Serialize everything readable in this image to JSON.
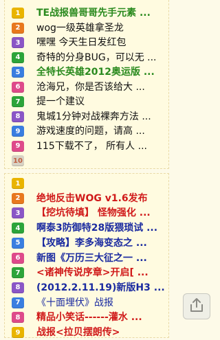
{
  "colors": {
    "green": "#2a8a1e",
    "black": "#111111",
    "red": "#d01a1a",
    "blue": "#1a2aa0",
    "badge_yellow": "#e9b400",
    "badge_orange": "#e8781e",
    "badge_purple": "#8a56c6",
    "badge_green": "#2ca43a",
    "badge_blue": "#3a7ee0",
    "badge_pink": "#de4a8a",
    "badge_grey": "#d8d2c4"
  },
  "list1": [
    {
      "num": "1",
      "text": "TE战报兽哥哥先手元素 ...",
      "color": "green",
      "bold": true
    },
    {
      "num": "2",
      "text": "wog一级英雄拿圣龙",
      "color": "black",
      "bold": false
    },
    {
      "num": "3",
      "text": "嘿嘿 今天生日发红包",
      "color": "black",
      "bold": false
    },
    {
      "num": "4",
      "text": "奇特的分身BUG，可以无 ...",
      "color": "black",
      "bold": false
    },
    {
      "num": "5",
      "text": "全特长英雄2012奥运版 ...",
      "color": "green",
      "bold": true
    },
    {
      "num": "6",
      "text": "沧海兄，你是否该给大 ...",
      "color": "black",
      "bold": false
    },
    {
      "num": "7",
      "text": "提一个建议",
      "color": "black",
      "bold": false
    },
    {
      "num": "8",
      "text": "鬼城1分钟对战裸奔方法 ...",
      "color": "black",
      "bold": false
    },
    {
      "num": "9",
      "text": "游戏速度的问题，请高 ...",
      "color": "black",
      "bold": false
    },
    {
      "num": "9",
      "text": "115下载不了， 所有人 ...",
      "color": "black",
      "bold": false
    },
    {
      "num": "10",
      "text": "",
      "color": "black",
      "bold": false
    }
  ],
  "list2": [
    {
      "num": "1",
      "text": "",
      "color": "black",
      "bold": false
    },
    {
      "num": "2",
      "text": "绝地反击WOG v1.6发布",
      "color": "red",
      "bold": true
    },
    {
      "num": "3",
      "text": "【挖坑待填】 怪物强化 ...",
      "color": "red",
      "bold": true
    },
    {
      "num": "4",
      "text": "啊泰3防御特28版猥琐试 ...",
      "color": "blue",
      "bold": true
    },
    {
      "num": "5",
      "text": "【攻略】李多海变态之 ...",
      "color": "blue",
      "bold": true
    },
    {
      "num": "6",
      "text": "新图《万历三大征之一 ...",
      "color": "blue",
      "bold": true
    },
    {
      "num": "7",
      "text": "<诸神传说序章>开启[ ...",
      "color": "red",
      "bold": true
    },
    {
      "num": "8",
      "text": "(2012.2.11.19)新版H3 ...",
      "color": "blue",
      "bold": true
    },
    {
      "num": "7",
      "text": "《十面埋伏》战报",
      "color": "blue",
      "bold": false
    },
    {
      "num": "8",
      "text": "精品小笑话------灌水 ...",
      "color": "red",
      "bold": true
    },
    {
      "num": "9",
      "text": "战报<拉贝摆朗传>",
      "color": "red",
      "bold": true
    }
  ],
  "share_icon": "share-icon"
}
